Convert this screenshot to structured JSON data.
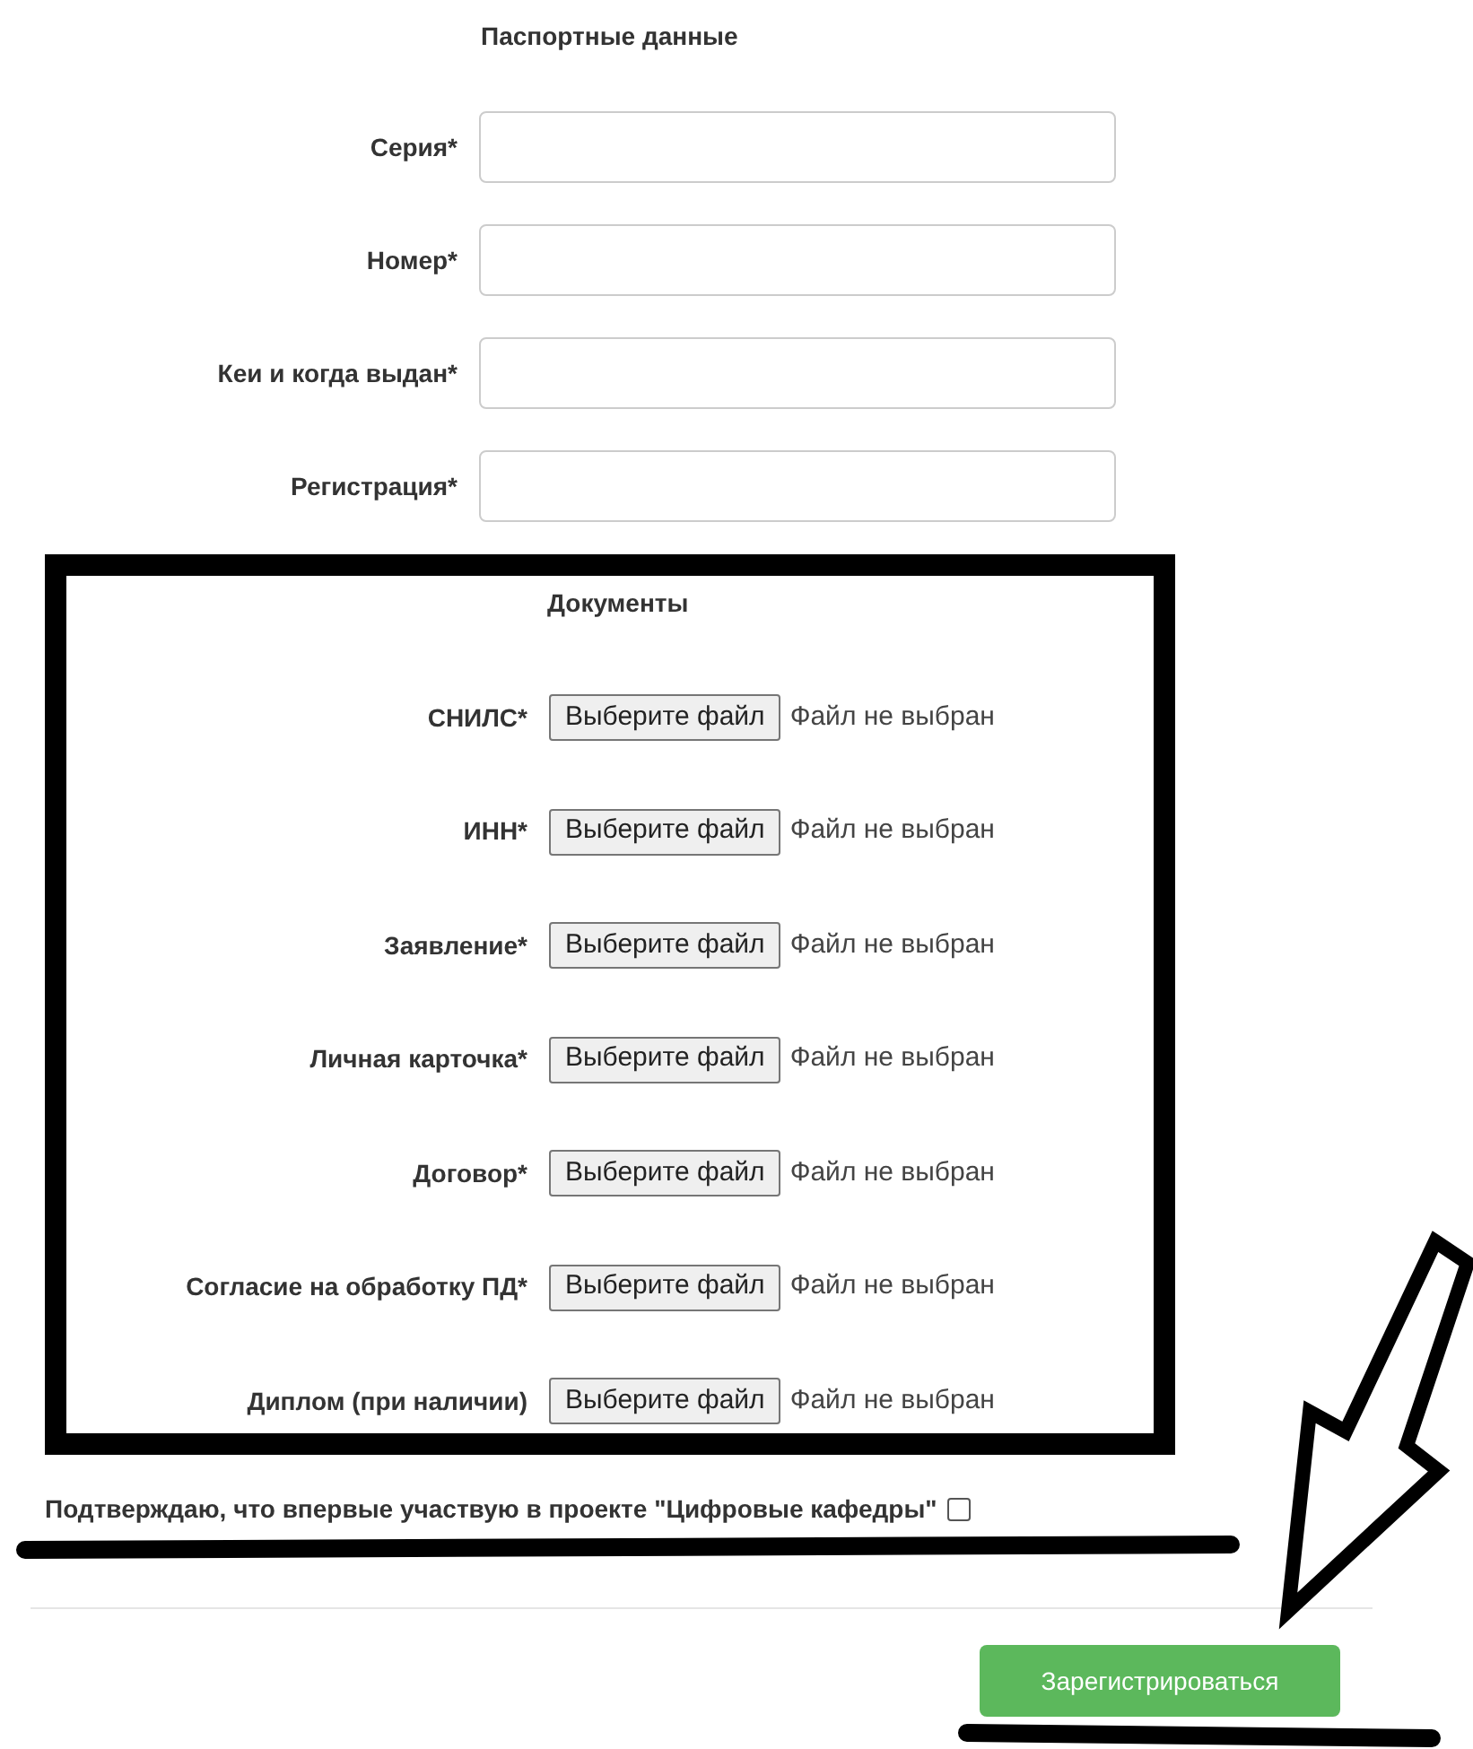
{
  "passport": {
    "title": "Паспортные данные",
    "fields": [
      {
        "label": "Серия*"
      },
      {
        "label": "Номер*"
      },
      {
        "label": "Кеи и когда выдан*"
      },
      {
        "label": "Регистрация*"
      }
    ]
  },
  "documents": {
    "title": "Документы",
    "files": [
      {
        "label": "СНИЛС*",
        "button": "Выберите файл",
        "status": "Файл не выбран"
      },
      {
        "label": "ИНН*",
        "button": "Выберите файл",
        "status": "Файл не выбран"
      },
      {
        "label": "Заявление*",
        "button": "Выберите файл",
        "status": "Файл не выбран"
      },
      {
        "label": "Личная карточка*",
        "button": "Выберите файл",
        "status": "Файл не выбран"
      },
      {
        "label": "Договор*",
        "button": "Выберите файл",
        "status": "Файл не выбран"
      },
      {
        "label": "Согласие на обработку ПД*",
        "button": "Выберите файл",
        "status": "Файл не выбран"
      },
      {
        "label": "Диплом (при наличии)",
        "button": "Выберите файл",
        "status": "Файл не выбран"
      }
    ]
  },
  "consent": {
    "text": "Подтверждаю, что впервые участвую в проекте \"Цифровые кафедры\"",
    "checked": false
  },
  "submit": {
    "label": "Зарегистрироваться"
  }
}
